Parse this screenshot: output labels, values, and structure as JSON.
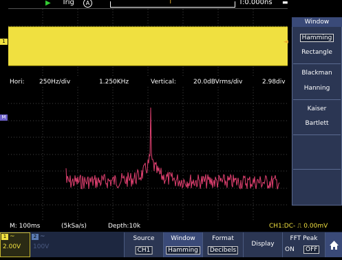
{
  "top": {
    "trig_label": "Trig",
    "auto_label": "A",
    "trig_pos_glyph": "T",
    "time_offset": "T:0.000ns"
  },
  "markers": {
    "ch1": "1",
    "math": "M",
    "trig_level": "◄"
  },
  "info": {
    "hori_label": "Hori:",
    "hori_value": "250Hz/div",
    "center_freq": "1.250KHz",
    "vertical_label": "Vertical:",
    "vertical_value": "20.0dBVrms/div",
    "vertical_offset": "2.98div"
  },
  "status": {
    "timebase": "M: 100ms",
    "sample_rate": "(5kSa/s)",
    "depth": "Depth:10k",
    "trigger": "CH1:DC- ⎍ 0.00mV"
  },
  "channels": {
    "ch1": {
      "tag": "1",
      "coupling": "~",
      "volts": "2.00V"
    },
    "ch2": {
      "tag": "2",
      "coupling": "~",
      "volts": "100V"
    }
  },
  "softkeys": [
    {
      "label": "Source",
      "value": "CH1"
    },
    {
      "label": "Window",
      "value": "Hamming"
    },
    {
      "label": "Format",
      "value": "Decibels"
    },
    {
      "label": "Display",
      "value": ""
    },
    {
      "label": "FFT Peak",
      "value": ""
    }
  ],
  "fft_peak": {
    "on": "ON",
    "off": "OFF"
  },
  "side_menu": {
    "title": "Window",
    "items": [
      "Hamming",
      "Rectangle",
      "Blackman",
      "Hanning",
      "Kaiser",
      "Bartlett"
    ],
    "selected": "Hamming"
  },
  "colors": {
    "ch1": "#f0e040",
    "fft_trace": "#e04070",
    "menu_bg": "#2b3653",
    "accent": "#3a4a78"
  },
  "icons": {
    "home": "home-icon",
    "run": "run-icon",
    "stop": "stop-icon"
  }
}
